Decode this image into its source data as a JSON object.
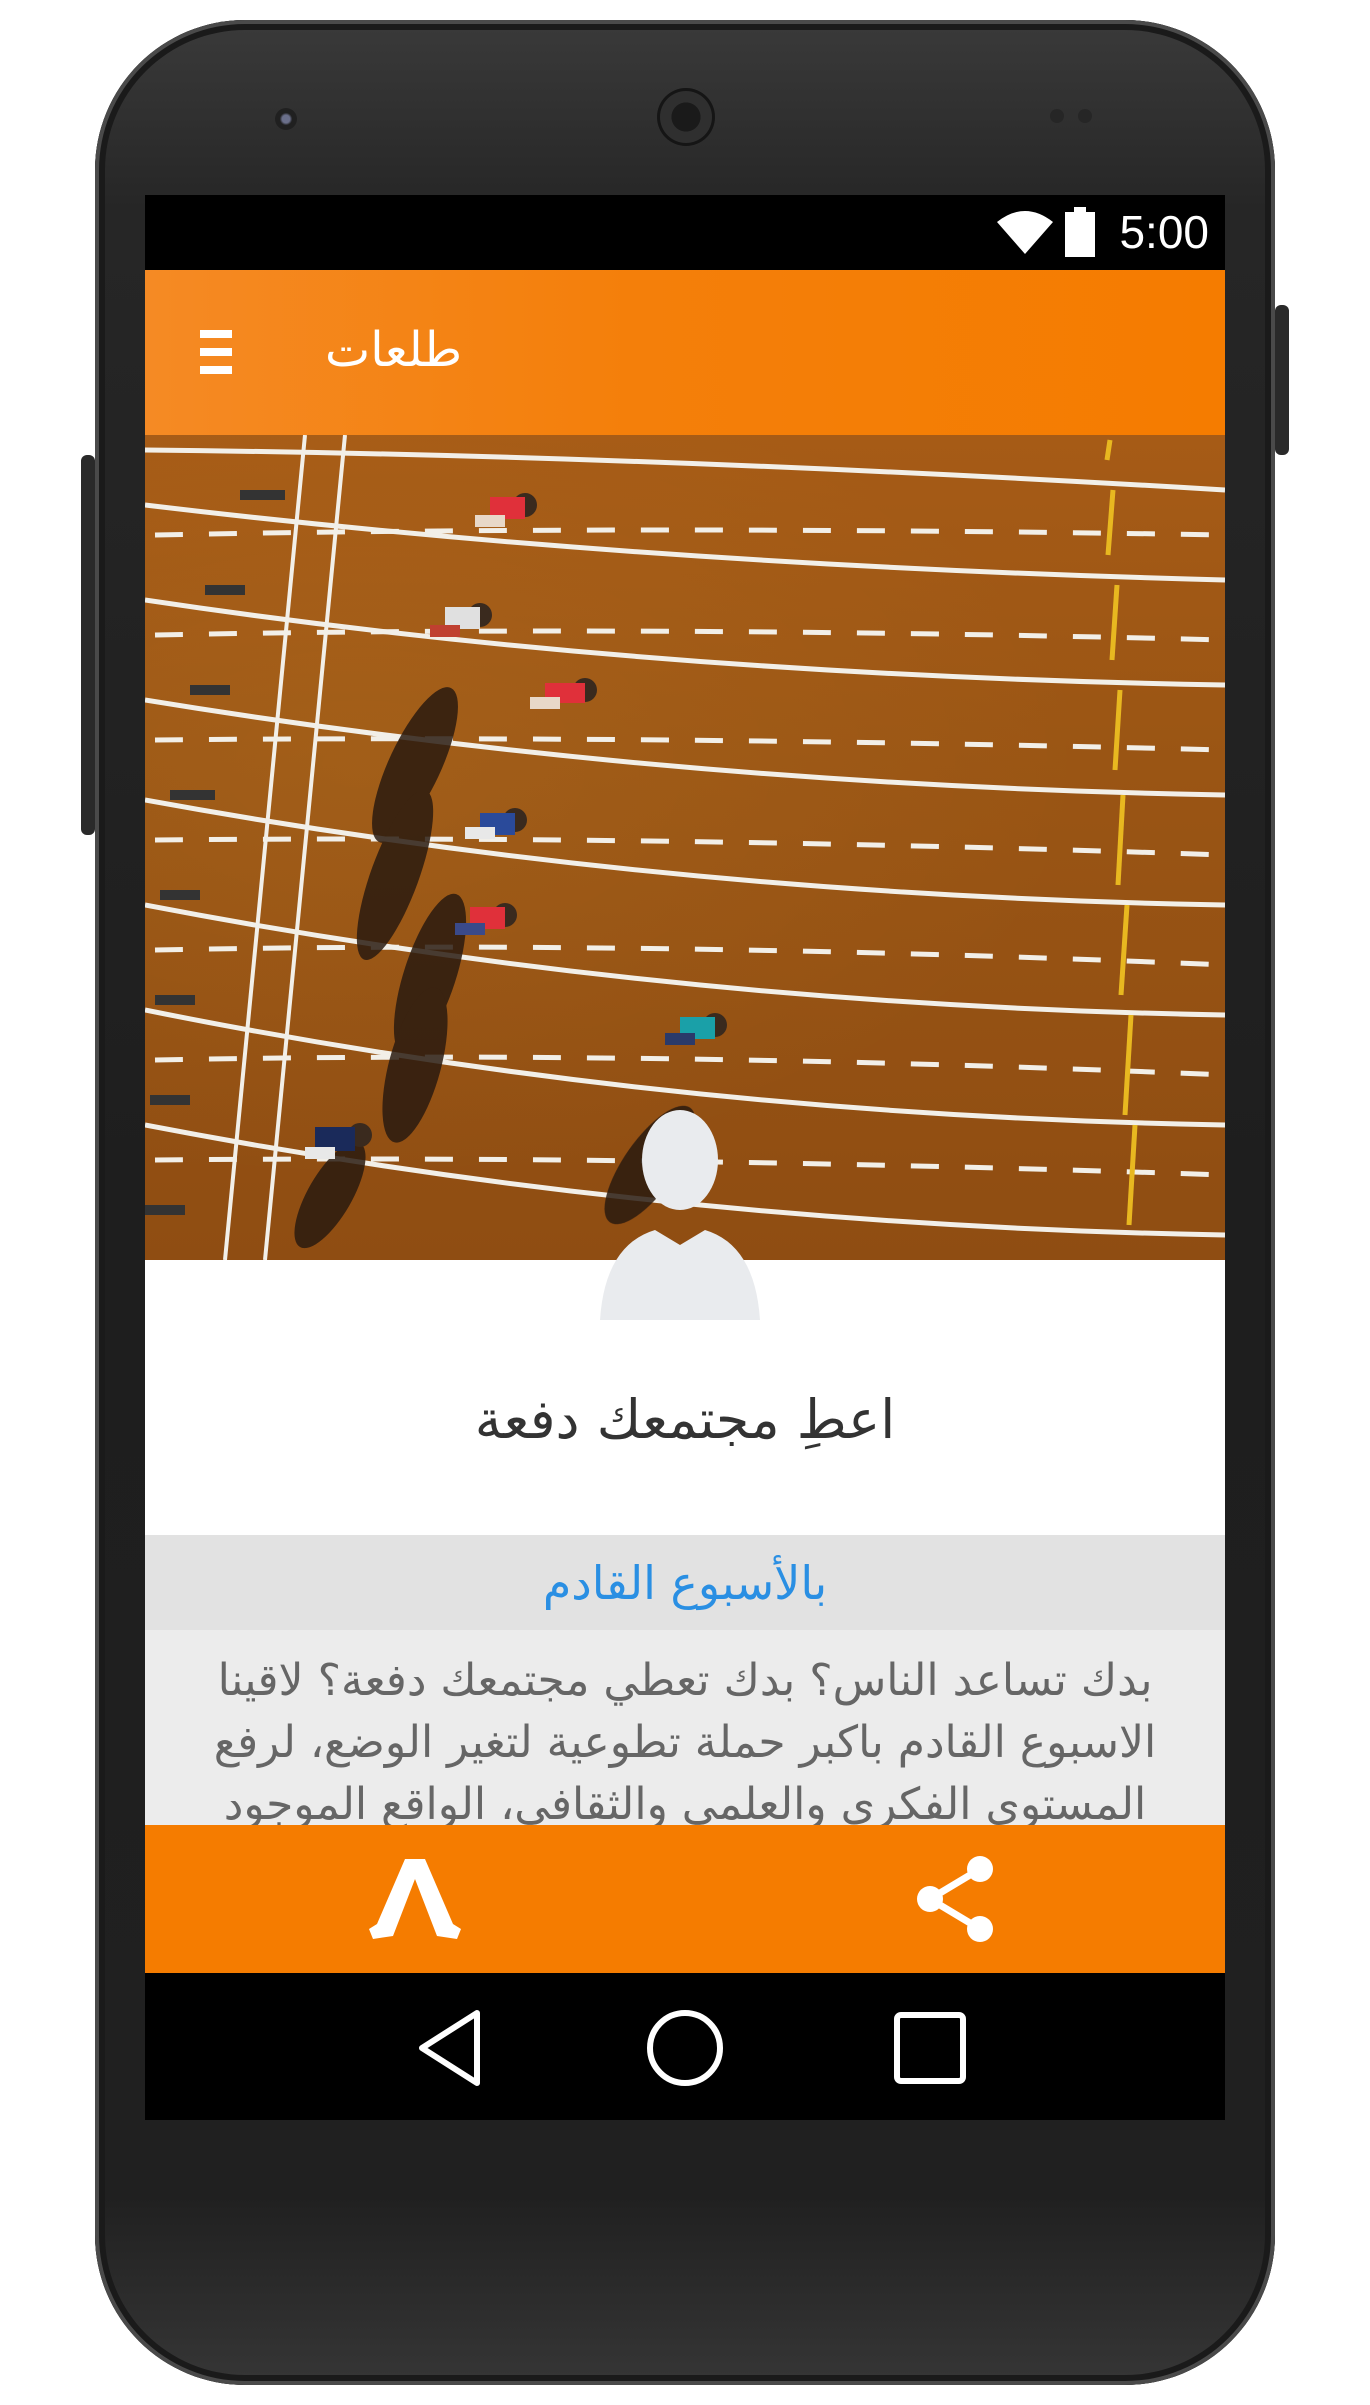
{
  "status_bar": {
    "time": "5:00",
    "wifi_icon": "wifi-icon",
    "battery_icon": "battery-icon"
  },
  "app_bar": {
    "title": "طلعات",
    "menu_icon": "menu-icon"
  },
  "hero": {
    "image": "running-track-photo",
    "avatar_icon": "user-silhouette-icon"
  },
  "content": {
    "headline": "اعطِ مجتمعك دفعة",
    "subtitle": "بالأسبوع القادم",
    "body": "بدك تساعد الناس؟ بدك تعطي مجتمعك دفعة؟ لاقينا الاسبوع القادم باكبر حملة تطوعية لتغير الوضع، لرفع المستوى الفكري والعلمي والثقافي، الواقع الموجود"
  },
  "bottom_actions": [
    {
      "name": "join-action",
      "icon": "walking-figure-icon"
    },
    {
      "name": "share-action",
      "icon": "share-icon"
    }
  ],
  "nav_bar": {
    "back_icon": "back-icon",
    "home_icon": "home-icon",
    "recents_icon": "recents-icon"
  },
  "colors": {
    "accent": "#f57c00",
    "link": "#2a8fe3",
    "status_bar": "#000000"
  }
}
